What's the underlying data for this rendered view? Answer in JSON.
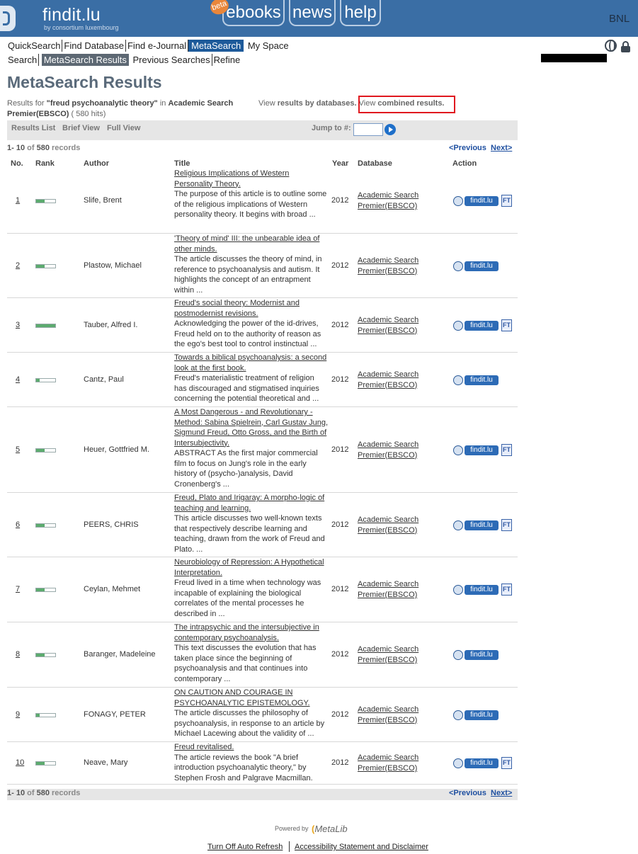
{
  "header": {
    "logo": "findit.lu",
    "logo_sub": "by consortium luxembourg",
    "beta": "beta",
    "tabs": [
      "ebooks",
      "news",
      "help"
    ],
    "institution": "BNL"
  },
  "nav": {
    "row1": [
      "QuickSearch",
      "Find Database",
      "Find e-Journal",
      "MetaSearch",
      "My Space"
    ],
    "row2": [
      "Search",
      "MetaSearch Results",
      "Previous Searches",
      "Refine"
    ]
  },
  "page_title": "MetaSearch Results",
  "results_for": {
    "prefix": "Results for ",
    "query": "\"freud psychoanalytic theory\"",
    "in": " in ",
    "database": "Academic Search Premier(EBSCO)",
    "hits": " ( 580 hits)"
  },
  "view": {
    "prefix": "View ",
    "by_databases": "results by databases.",
    "view2": " View ",
    "combined": "combined results."
  },
  "toolbar": {
    "results_list": "Results List",
    "brief_view": "Brief View",
    "full_view": "Full View",
    "jump_to": "Jump to #:"
  },
  "counts": {
    "range": "1- 10",
    "of": " of ",
    "total": "580",
    "records": " records"
  },
  "pagination": {
    "previous": "<Previous",
    "next": "Next>"
  },
  "columns": [
    "No.",
    "Rank",
    "Author",
    "Title",
    "Year",
    "Database",
    "Action"
  ],
  "action_labels": {
    "findit": "findit.lu",
    "fulltext": "FT"
  },
  "results": [
    {
      "no": "1",
      "rank": 0.45,
      "author": "Slife, Brent",
      "title": "Religious Implications of Western Personality Theory.",
      "abstract": "The purpose of this article is to outline some of the religious implications of Western personality theory. It begins with broad ...",
      "year": "2012",
      "database": "Academic Search Premier(EBSCO)",
      "fulltext": true
    },
    {
      "no": "2",
      "rank": 0.45,
      "author": "Plastow, Michael",
      "title": "'Theory of mind' III: the unbearable idea of other minds.",
      "abstract": "The article discusses the theory of mind, in reference to psychoanalysis and autism. It highlights the concept of an entrapment within ...",
      "year": "2012",
      "database": "Academic Search Premier(EBSCO)",
      "fulltext": false
    },
    {
      "no": "3",
      "rank": 1.0,
      "author": "Tauber, Alfred I.",
      "title": "Freud's social theory: Modernist and postmodernist revisions.",
      "abstract": "Acknowledging the power of the id-drives, Freud held on to the authority of reason as the ego's best tool to control instinctual ...",
      "year": "2012",
      "database": "Academic Search Premier(EBSCO)",
      "fulltext": true
    },
    {
      "no": "4",
      "rank": 0.2,
      "author": "Cantz, Paul",
      "title": "Towards a biblical psychoanalysis: a second look at the first book.",
      "abstract": "Freud's materialistic treatment of religion has discouraged and stigmatised inquiries concerning the potential theoretical and ...",
      "year": "2012",
      "database": "Academic Search Premier(EBSCO)",
      "fulltext": false
    },
    {
      "no": "5",
      "rank": 0.45,
      "author": "Heuer, Gottfried M.",
      "title": "A Most Dangerous - and Revolutionary - Method: Sabina Spielrein, Carl Gustav Jung, Sigmund Freud, Otto Gross, and the Birth of Intersubjectivity.",
      "abstract": "ABSTRACT As the first major commercial film to focus on Jung's role in the early history of (psycho-)analysis, David Cronenberg's ...",
      "year": "2012",
      "database": "Academic Search Premier(EBSCO)",
      "fulltext": true
    },
    {
      "no": "6",
      "rank": 0.45,
      "author": "PEERS, CHRIS",
      "title": "Freud, Plato and Irigaray: A morpho-logic of teaching and learning.",
      "abstract": "This article discusses two well-known texts that respectively describe learning and teaching, drawn from the work of Freud and Plato. ...",
      "year": "2012",
      "database": "Academic Search Premier(EBSCO)",
      "fulltext": true
    },
    {
      "no": "7",
      "rank": 0.45,
      "author": "Ceylan, Mehmet",
      "title": "Neurobiology of Repression: A Hypothetical Interpretation.",
      "abstract": "Freud lived in a time when technology was incapable of explaining the biological correlates of the mental processes he described in ...",
      "year": "2012",
      "database": "Academic Search Premier(EBSCO)",
      "fulltext": true
    },
    {
      "no": "8",
      "rank": 0.45,
      "author": "Baranger, Madeleine",
      "title": "The intrapsychic and the intersubjective in contemporary psychoanalysis.",
      "abstract": "This text discusses the evolution that has taken place since the beginning of psychoanalysis and that continues into contemporary ...",
      "year": "2012",
      "database": "Academic Search Premier(EBSCO)",
      "fulltext": false
    },
    {
      "no": "9",
      "rank": 0.2,
      "author": "FONAGY, PETER",
      "title": "ON CAUTION AND COURAGE IN PSYCHOANALYTIC EPISTEMOLOGY.",
      "abstract": "The article discusses the philosophy of psychoanalysis, in response to an article by Michael Lacewing about the validity of ...",
      "year": "2012",
      "database": "Academic Search Premier(EBSCO)",
      "fulltext": false
    },
    {
      "no": "10",
      "rank": 0.45,
      "author": "Neave, Mary",
      "title": "Freud revitalised.",
      "abstract": "The article reviews the book \"A brief introduction psychoanalytic theory,\" by Stephen Frosh and Palgrave Macmillan.",
      "year": "2012",
      "database": "Academic Search Premier(EBSCO)",
      "fulltext": true
    }
  ],
  "footer": {
    "powered_by": "Powered by",
    "metalib": "MetaLib",
    "links": [
      "Turn Off Auto Refresh",
      "Accessibility Statement and Disclaimer"
    ]
  }
}
